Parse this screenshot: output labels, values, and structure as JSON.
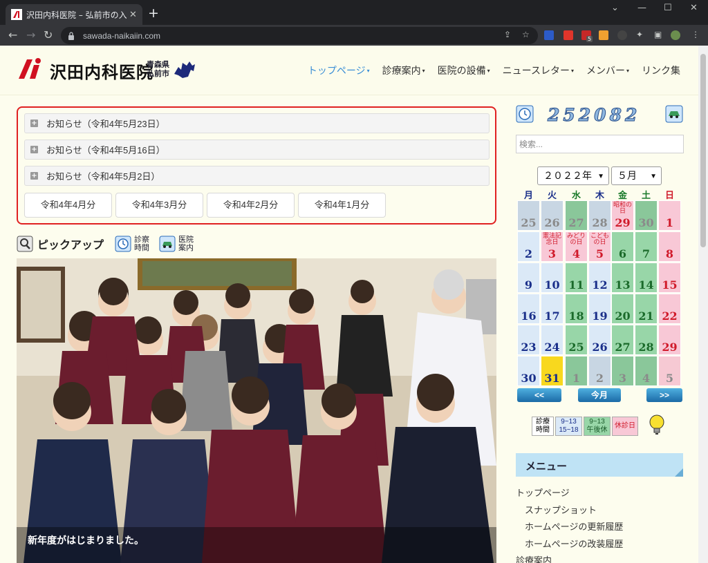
{
  "browser": {
    "tab_title": "沢田内科医院 – 弘前市の入院設備",
    "new_tab_symbol": "+",
    "url": "sawada-naikaiin.com",
    "badge_count": "5"
  },
  "site": {
    "logo_text": "沢田内科医院",
    "logo_sub_line1": "青森県",
    "logo_sub_line2": "弘前市"
  },
  "nav": [
    {
      "label": "トップページ",
      "caret": "▾"
    },
    {
      "label": "診療案内",
      "caret": "▾"
    },
    {
      "label": "医院の設備",
      "caret": "▾"
    },
    {
      "label": "ニュースレター",
      "caret": "▾"
    },
    {
      "label": "メンバー",
      "caret": "▾"
    },
    {
      "label": "リンク集",
      "caret": ""
    }
  ],
  "notices": [
    "お知らせ（令和4年5月23日）",
    "お知らせ（令和4年5月16日）",
    "お知らせ（令和4年5月2日）"
  ],
  "month_buttons": [
    "令和4年4月分",
    "令和4年3月分",
    "令和4年2月分",
    "令和4年1月分"
  ],
  "pickup": {
    "title": "ピックアップ",
    "link1_line1": "診察",
    "link1_line2": "時間",
    "link2_line1": "医院",
    "link2_line2": "案内"
  },
  "photo_caption": "新年度がはじまりました。",
  "counter": "252082",
  "search": {
    "placeholder": "検索..."
  },
  "calendar": {
    "year_select": "２０２２年",
    "month_select": "５月",
    "weekdays": [
      "月",
      "火",
      "水",
      "木",
      "金",
      "土",
      "日"
    ],
    "weekday_colors": [
      "#1a2f8a",
      "#1a2f8a",
      "#1a7a2a",
      "#1a2f8a",
      "#1a7a2a",
      "#1a7a2a",
      "#d01a2a"
    ],
    "rows": [
      [
        {
          "d": "25",
          "t": "out"
        },
        {
          "d": "26",
          "t": "out"
        },
        {
          "d": "27",
          "t": "out"
        },
        {
          "d": "28",
          "t": "out"
        },
        {
          "d": "29",
          "t": "hol",
          "ev": "昭和の日"
        },
        {
          "d": "30",
          "t": "out"
        },
        {
          "d": "1",
          "t": "sun"
        }
      ],
      [
        {
          "d": "2",
          "t": "wk"
        },
        {
          "d": "3",
          "t": "hol",
          "ev": "憲法記念日"
        },
        {
          "d": "4",
          "t": "hol",
          "ev": "みどりの日"
        },
        {
          "d": "5",
          "t": "hol",
          "ev": "こどもの日"
        },
        {
          "d": "6",
          "t": "am"
        },
        {
          "d": "7",
          "t": "am"
        },
        {
          "d": "8",
          "t": "sun"
        }
      ],
      [
        {
          "d": "9",
          "t": "wk"
        },
        {
          "d": "10",
          "t": "wk"
        },
        {
          "d": "11",
          "t": "am"
        },
        {
          "d": "12",
          "t": "wk"
        },
        {
          "d": "13",
          "t": "am"
        },
        {
          "d": "14",
          "t": "am"
        },
        {
          "d": "15",
          "t": "sun"
        }
      ],
      [
        {
          "d": "16",
          "t": "wk"
        },
        {
          "d": "17",
          "t": "wk"
        },
        {
          "d": "18",
          "t": "am"
        },
        {
          "d": "19",
          "t": "wk"
        },
        {
          "d": "20",
          "t": "am"
        },
        {
          "d": "21",
          "t": "am"
        },
        {
          "d": "22",
          "t": "sun"
        }
      ],
      [
        {
          "d": "23",
          "t": "wk"
        },
        {
          "d": "24",
          "t": "wk"
        },
        {
          "d": "25",
          "t": "am"
        },
        {
          "d": "26",
          "t": "wk"
        },
        {
          "d": "27",
          "t": "am"
        },
        {
          "d": "28",
          "t": "am"
        },
        {
          "d": "29",
          "t": "sun"
        }
      ],
      [
        {
          "d": "30",
          "t": "wk"
        },
        {
          "d": "31",
          "t": "today"
        },
        {
          "d": "1",
          "t": "out"
        },
        {
          "d": "2",
          "t": "out"
        },
        {
          "d": "3",
          "t": "out"
        },
        {
          "d": "4",
          "t": "out"
        },
        {
          "d": "5",
          "t": "outsun"
        }
      ]
    ],
    "prev_label": "<<",
    "today_label": "今月",
    "next_label": ">>"
  },
  "legend": {
    "hours_line1": "診療",
    "hours_line2": "時間",
    "full_line1": "9~13",
    "full_line2": "15~18",
    "half_line1": "9~13",
    "half_line2": "午後休",
    "closed": "休診日"
  },
  "menu": {
    "title": "メニュー",
    "items": [
      {
        "label": "トップページ",
        "indent": false
      },
      {
        "label": "スナップショット",
        "indent": true
      },
      {
        "label": "ホームページの更新履歴",
        "indent": true
      },
      {
        "label": "ホームページの改装履歴",
        "indent": true
      },
      {
        "label": "診療案内",
        "indent": false
      }
    ]
  },
  "colors": {
    "accent": "#3a8ed6",
    "notice_border": "#e02020",
    "cal_weekday": "#dbe9f7",
    "cal_am": "#98d6a8",
    "cal_holiday": "#f8c8d6",
    "cal_today": "#f8d81e"
  }
}
